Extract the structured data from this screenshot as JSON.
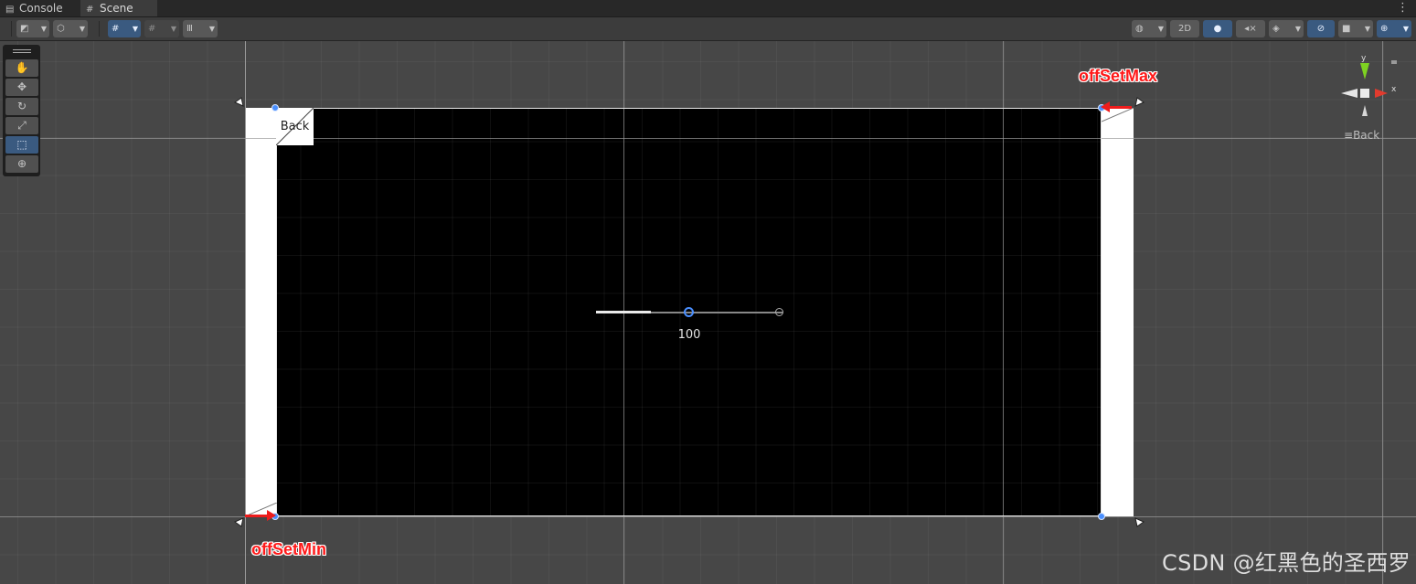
{
  "tabs": [
    {
      "label": "Console",
      "icon": "console-icon",
      "active": false
    },
    {
      "label": "Scene",
      "icon": "scene-grid-icon",
      "active": true
    }
  ],
  "toolbar": {
    "two_d_label": "2D",
    "accent": "#3a5a80"
  },
  "tools": [
    {
      "name": "hand-tool",
      "icon": "hand-icon",
      "glyph": "✋",
      "active": false
    },
    {
      "name": "move-tool",
      "icon": "move-arrows-icon",
      "glyph": "✥",
      "active": false
    },
    {
      "name": "rotate-tool",
      "icon": "rotate-icon",
      "glyph": "↻",
      "active": false
    },
    {
      "name": "scale-tool",
      "icon": "scale-icon",
      "glyph": "⤢",
      "active": false
    },
    {
      "name": "rect-tool",
      "icon": "rect-transform-icon",
      "glyph": "⬚",
      "active": true
    },
    {
      "name": "transform-tool",
      "icon": "transform-gizmo-icon",
      "glyph": "⊕",
      "active": false
    }
  ],
  "scene": {
    "back_button_text": "Back",
    "slider_value": "100",
    "gizmo_y": "y",
    "gizmo_x": "x",
    "orientation_label": "Back"
  },
  "annotations": {
    "offset_max": "offSetMax",
    "offset_min": "offSetMin",
    "color": "#ff1a1a"
  },
  "watermark": "CSDN @红黑色的圣西罗"
}
